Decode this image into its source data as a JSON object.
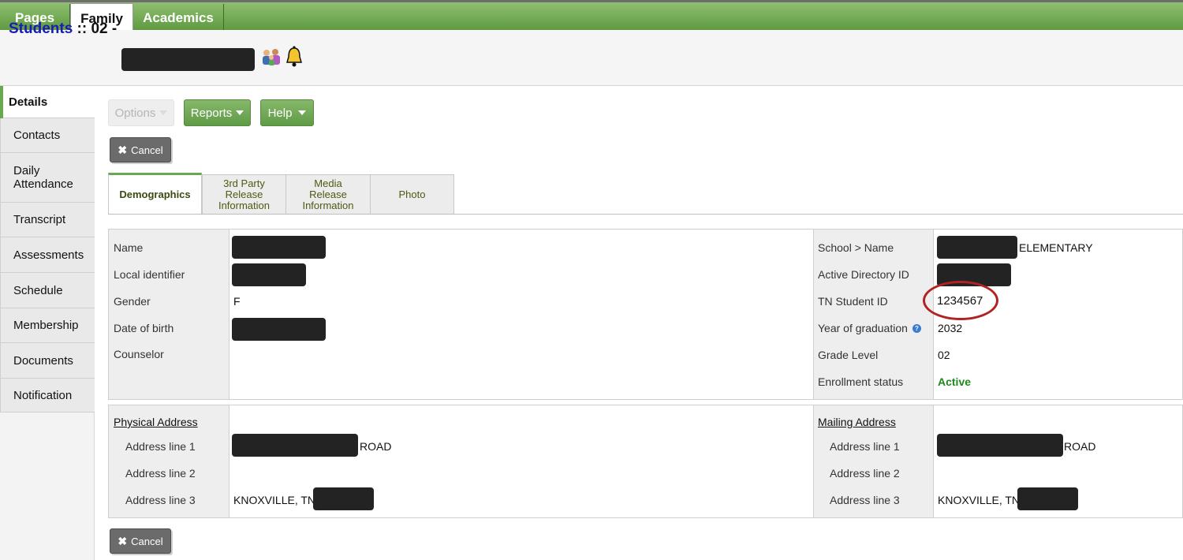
{
  "topnav": {
    "tabs": [
      "Pages",
      "Family",
      "Academics"
    ]
  },
  "header": {
    "title_link": "Students",
    "title_rest": " :: 02 - "
  },
  "sidenav": {
    "items": [
      "Details",
      "Contacts",
      "Daily Attendance",
      "Transcript",
      "Assessments",
      "Schedule",
      "Membership",
      "Documents",
      "Notification"
    ]
  },
  "toolbar": {
    "options_label": "Options",
    "reports_label": "Reports",
    "help_label": "Help",
    "cancel_label": "Cancel"
  },
  "subtabs": [
    "Demographics",
    "3rd Party Release Information",
    "Media Release Information",
    "Photo"
  ],
  "demographics": {
    "left_labels": [
      "Name",
      "Local identifier",
      "Gender",
      "Date of birth",
      "Counselor"
    ],
    "gender": "F",
    "right_labels": [
      "School > Name",
      "Active Directory ID",
      "TN Student ID",
      "Year of graduation",
      "Grade Level",
      "Enrollment status"
    ],
    "school_suffix": "ELEMENTARY",
    "tn_student_id": "1234567",
    "year_of_graduation": "2032",
    "grade_level": "02",
    "enrollment_status": "Active",
    "status_color": "#1d8a1d"
  },
  "addresses": {
    "physical_title": "Physical Address",
    "mailing_title": "Mailing Address",
    "line_labels": [
      "Address line 1",
      "Address line 2",
      "Address line 3"
    ],
    "physical_line1_suffix": "ROAD",
    "physical_line3_prefix": "KNOXVILLE, TN",
    "mailing_line1_suffix": "ROAD",
    "mailing_line3_prefix": "KNOXVILLE, TN"
  },
  "icons": {
    "family": "family-icon",
    "bell": "bell-icon",
    "cancel": "close-icon",
    "help": "help-icon"
  },
  "colors": {
    "nav_green": "#6aa84f",
    "link_blue": "#1a1ab4",
    "highlight": "#b22222"
  }
}
